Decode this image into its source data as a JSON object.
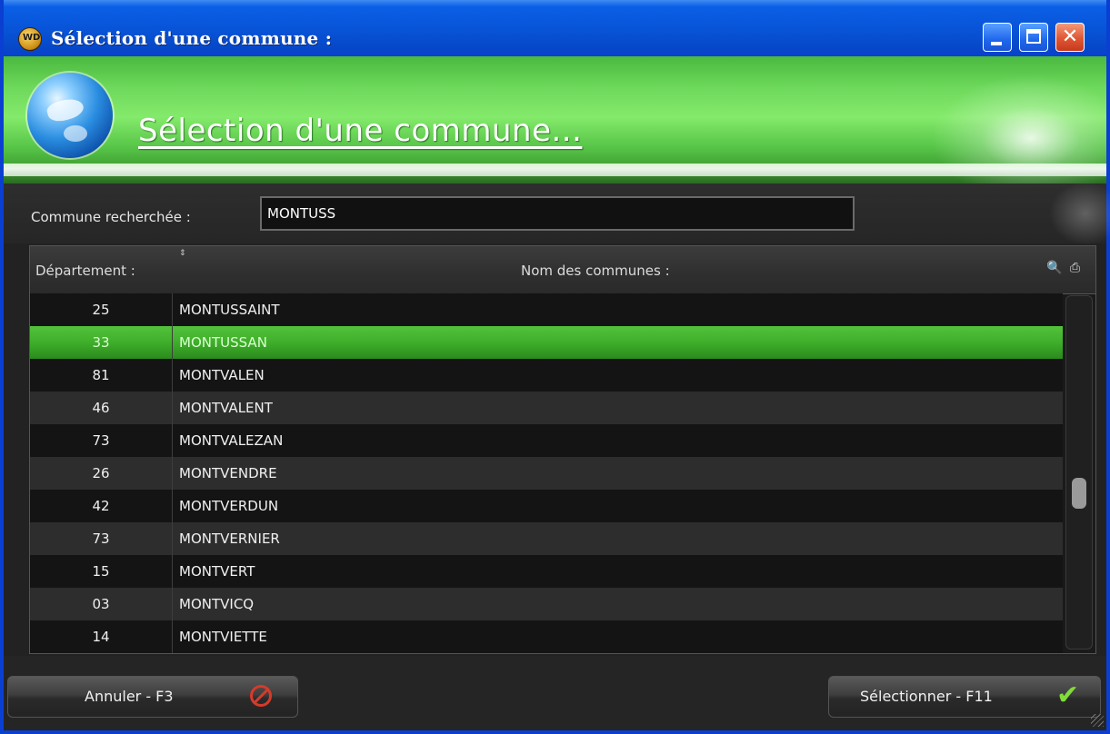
{
  "window": {
    "title": "Sélection d'une commune :",
    "app_icon": "windev-icon",
    "app_icon_text": "WD",
    "close_glyph": "✕"
  },
  "banner": {
    "title": "Sélection d'une commune...",
    "icon": "globe-icon"
  },
  "search": {
    "label": "Commune recherchée :",
    "value": "MONTUSS"
  },
  "table": {
    "columns": [
      "Département :",
      "Nom des communes :"
    ],
    "sort_icon": "⇕",
    "header_icons": [
      "🔍",
      "⎙"
    ],
    "rows": [
      {
        "dept": "25",
        "name": "MONTUSSAINT"
      },
      {
        "dept": "33",
        "name": "MONTUSSAN",
        "selected": true
      },
      {
        "dept": "81",
        "name": "MONTVALEN"
      },
      {
        "dept": "46",
        "name": "MONTVALENT"
      },
      {
        "dept": "73",
        "name": "MONTVALEZAN"
      },
      {
        "dept": "26",
        "name": "MONTVENDRE"
      },
      {
        "dept": "42",
        "name": "MONTVERDUN"
      },
      {
        "dept": "73",
        "name": "MONTVERNIER"
      },
      {
        "dept": "15",
        "name": "MONTVERT"
      },
      {
        "dept": "03",
        "name": "MONTVICQ"
      },
      {
        "dept": "14",
        "name": "MONTVIETTE"
      }
    ]
  },
  "buttons": {
    "cancel": "Annuler - F3",
    "select": "Sélectionner - F11",
    "check_glyph": "✔"
  },
  "colors": {
    "banner_green": "#6ed95c",
    "selected_row": "#3fae2b",
    "titlebar_blue": "#0853d6"
  }
}
